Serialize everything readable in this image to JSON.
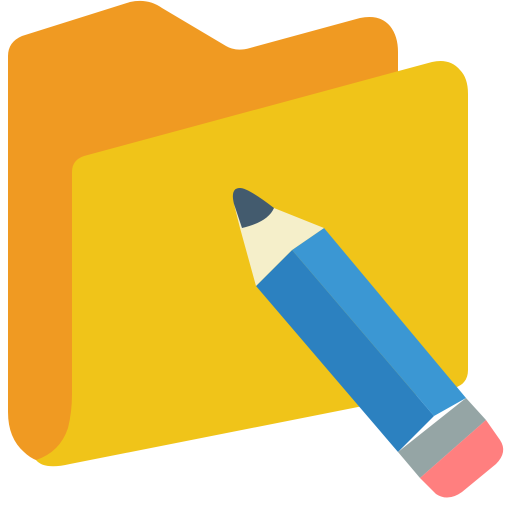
{
  "icon": {
    "name": "folder-edit-icon",
    "parts": {
      "folder_back": "folder-back-panel",
      "folder_front": "folder-front-panel",
      "pencil": "pencil-icon"
    }
  },
  "colors": {
    "folder_back": "#F09A22",
    "folder_front": "#F0C419",
    "pencil_body_light": "#3B97D3",
    "pencil_body_dark": "#2C81C0",
    "pencil_wood": "#F5EFCA",
    "pencil_lead": "#435B6E",
    "pencil_ferrule": "#95A5A5",
    "pencil_eraser": "#FF7F7F"
  }
}
